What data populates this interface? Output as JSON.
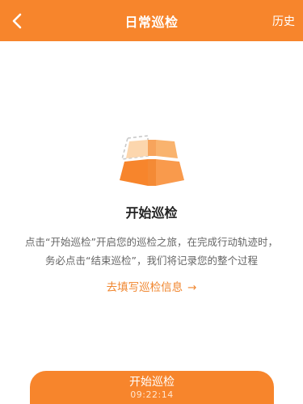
{
  "navbar": {
    "title": "日常巡检",
    "history_label": "历史",
    "back_icon": "chevron-left-icon"
  },
  "main": {
    "illustration_icon": "map-grid-icon",
    "title": "开始巡检",
    "description_line1": "点击“开始巡检”开启您的巡检之旅，在完成行动轨迹时，",
    "description_line2": "务必点击“结束巡检”，我们将记录您的整个过程",
    "fill_link_label": "去填写巡检信息",
    "fill_link_arrow": "→"
  },
  "start_button": {
    "label": "开始巡检",
    "timer": "09:22:14"
  },
  "colors": {
    "accent": "#f7852c",
    "link": "#f0852d",
    "title_text": "#222222",
    "body_text": "#666666"
  }
}
